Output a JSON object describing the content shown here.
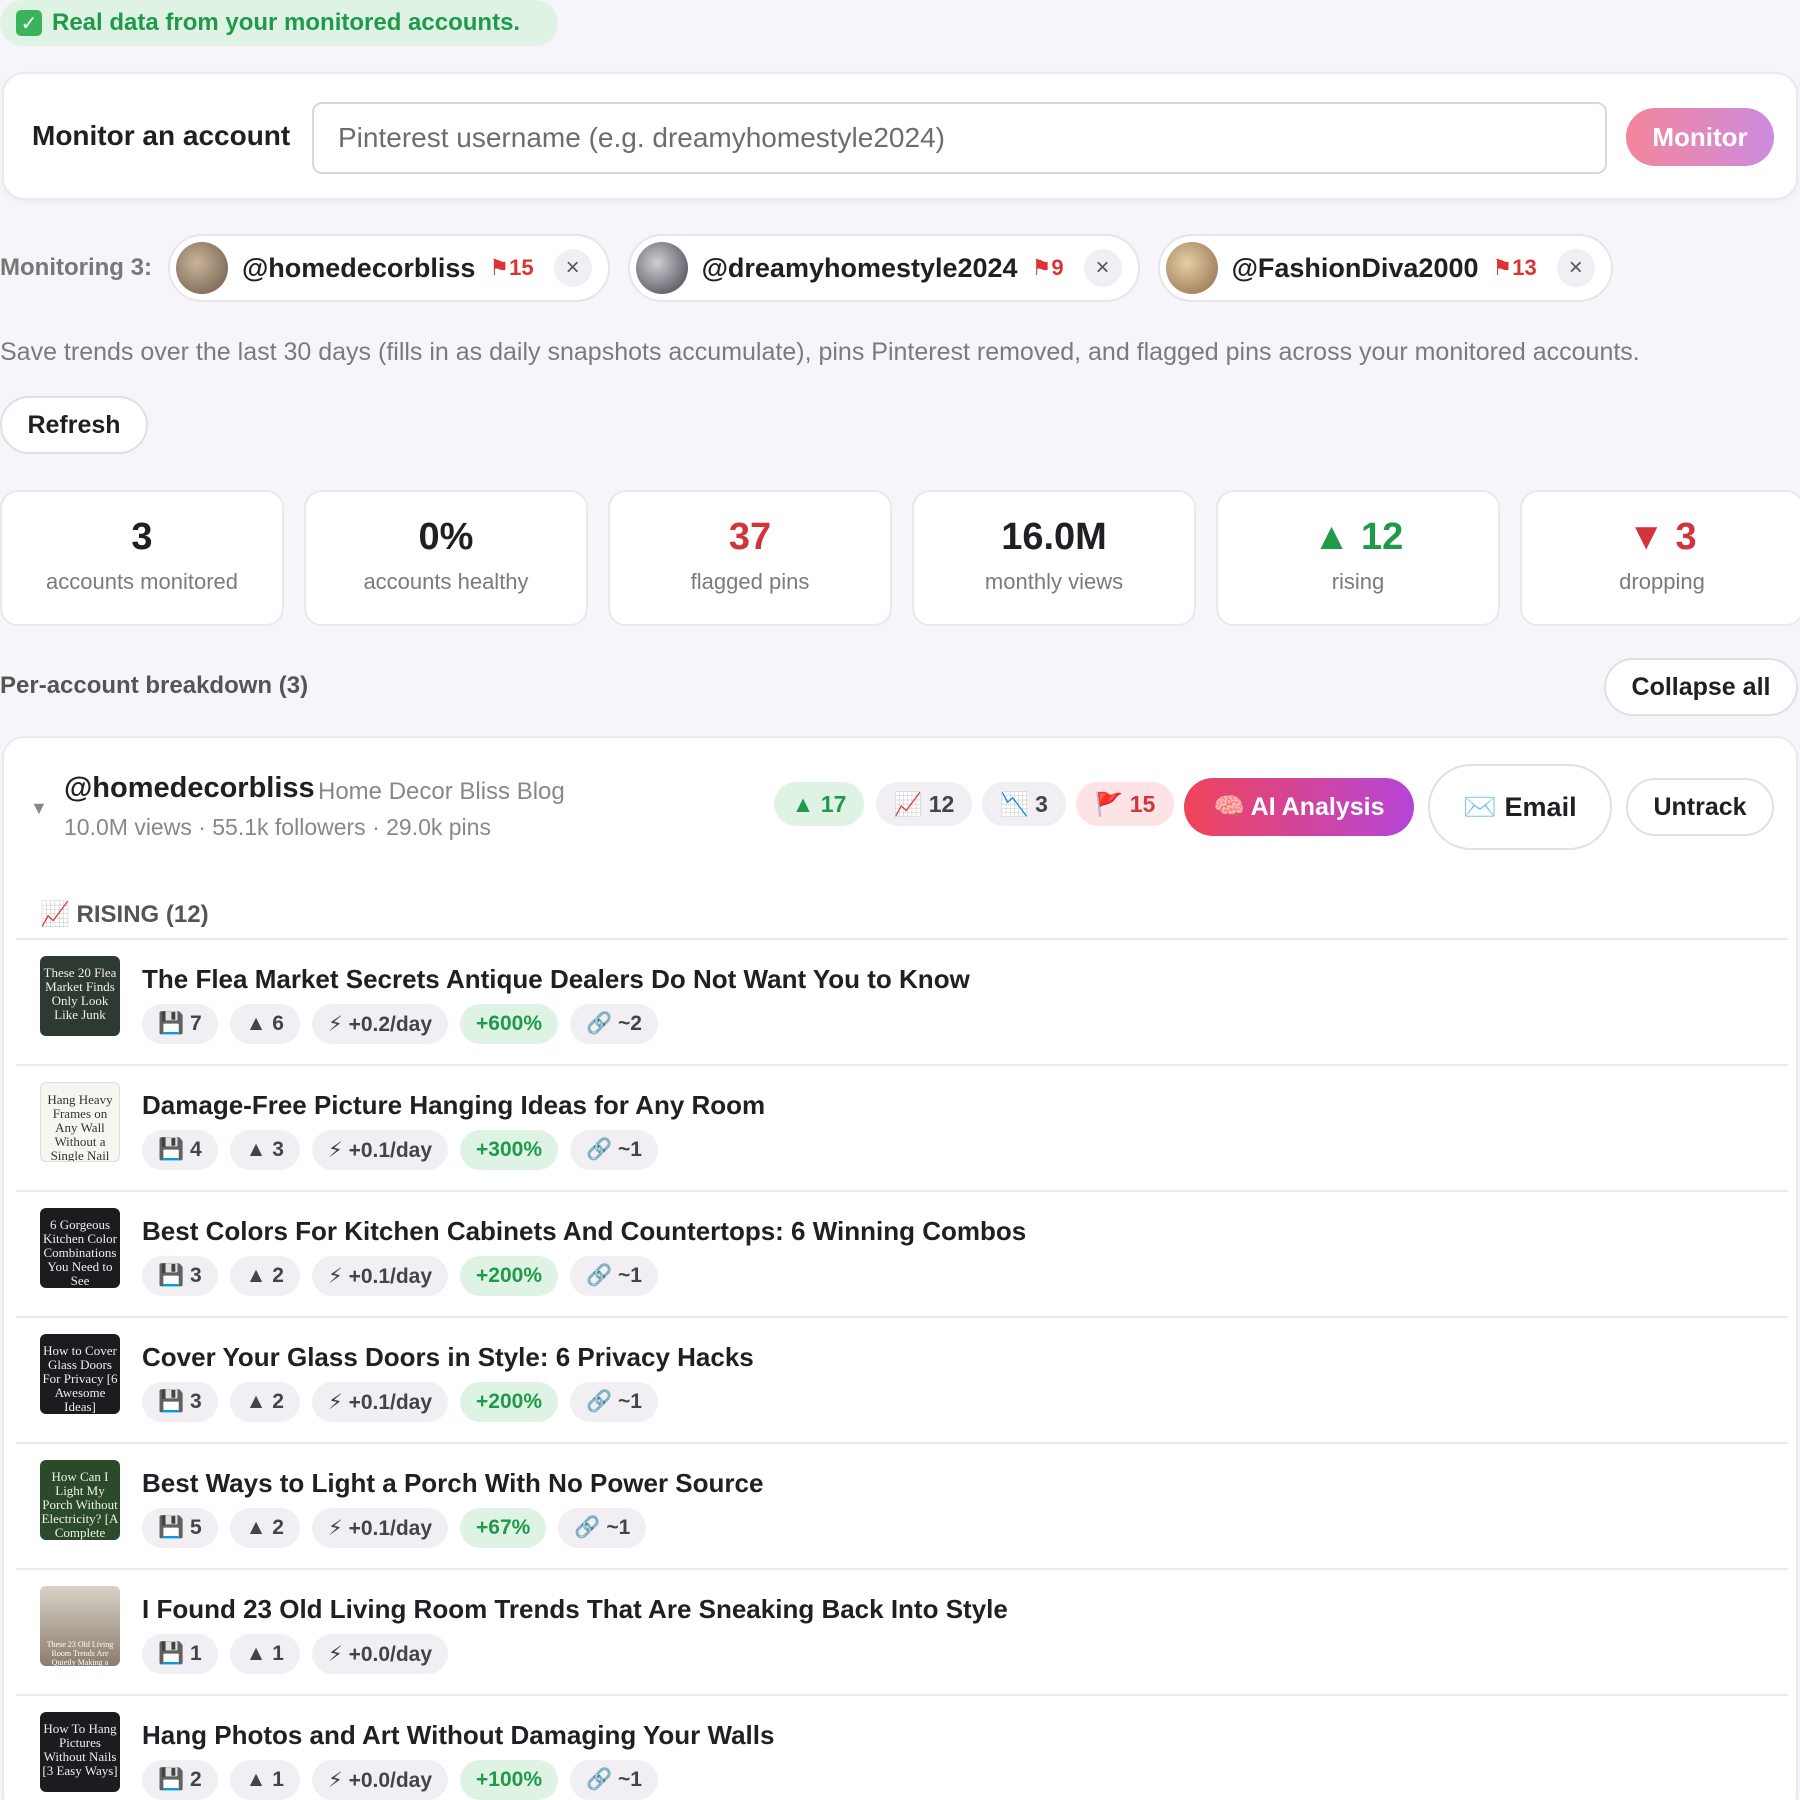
{
  "banner": {
    "text": "Real data from your monitored accounts.",
    "icon": "check-icon"
  },
  "monitor": {
    "label": "Monitor an account",
    "placeholder": "Pinterest username (e.g. dreamyhomestyle2024)",
    "button": "Monitor"
  },
  "monitoring": {
    "label": "Monitoring 3:",
    "accounts": [
      {
        "name": "@homedecorbliss",
        "flags": "15"
      },
      {
        "name": "@dreamyhomestyle2024",
        "flags": "9"
      },
      {
        "name": "@FashionDiva2000",
        "flags": "13"
      }
    ]
  },
  "description": "Save trends over the last 30 days (fills in as daily snapshots accumulate), pins Pinterest removed, and flagged pins across your monitored accounts.",
  "refresh_label": "Refresh",
  "stats": [
    {
      "value": "3",
      "label": "accounts monitored"
    },
    {
      "value": "0%",
      "label": "accounts healthy"
    },
    {
      "value": "37",
      "label": "flagged pins"
    },
    {
      "value": "16.0M",
      "label": "monthly views"
    },
    {
      "value": "▲ 12",
      "label": "rising"
    },
    {
      "value": "▼ 3",
      "label": "dropping"
    }
  ],
  "breakdown": {
    "title": "Per-account breakdown (3)",
    "collapse": "Collapse all"
  },
  "account": {
    "name": "@homedecorbliss",
    "subtitle": "Home Decor Bliss Blog",
    "meta": "10.0M views · 55.1k followers · 29.0k pins",
    "pills": {
      "up": "▲ 17",
      "rising": "📈 12",
      "dropping": "📉 3",
      "flags": "🚩 15"
    },
    "ai_label": "🧠 AI Analysis",
    "email_label": "✉️ Email",
    "untrack_label": "Untrack",
    "rising_header": "📈 RISING (12)"
  },
  "pins": [
    {
      "title": "The Flea Market Secrets Antique Dealers Do Not Want You to Know",
      "thumb": "These 20 Flea Market Finds Only Look Like Junk",
      "saves": "💾 7",
      "up": "▲ 6",
      "rate": "⚡ +0.2/day",
      "pct": "+600%",
      "links": "🔗 ~2"
    },
    {
      "title": "Damage-Free Picture Hanging Ideas for Any Room",
      "thumb": "Hang Heavy Frames on Any Wall Without a Single Nail",
      "saves": "💾 4",
      "up": "▲ 3",
      "rate": "⚡ +0.1/day",
      "pct": "+300%",
      "links": "🔗 ~1"
    },
    {
      "title": "Best Colors For Kitchen Cabinets And Countertops: 6 Winning Combos",
      "thumb": "6 Gorgeous Kitchen Color Combinations You Need to See",
      "saves": "💾 3",
      "up": "▲ 2",
      "rate": "⚡ +0.1/day",
      "pct": "+200%",
      "links": "🔗 ~1"
    },
    {
      "title": "Cover Your Glass Doors in Style: 6 Privacy Hacks",
      "thumb": "How to Cover Glass Doors For Privacy [6 Awesome Ideas]",
      "saves": "💾 3",
      "up": "▲ 2",
      "rate": "⚡ +0.1/day",
      "pct": "+200%",
      "links": "🔗 ~1"
    },
    {
      "title": "Best Ways to Light a Porch With No Power Source",
      "thumb": "How Can I Light My Porch Without Electricity? [A Complete Guide]",
      "saves": "💾 5",
      "up": "▲ 2",
      "rate": "⚡ +0.1/day",
      "pct": "+67%",
      "links": "🔗 ~1"
    },
    {
      "title": "I Found 23 Old Living Room Trends That Are Sneaking Back Into Style",
      "thumb": "These 23 Old Living Room Trends Are Quietly Making a",
      "saves": "💾 1",
      "up": "▲ 1",
      "rate": "⚡ +0.0/day",
      "pct": "",
      "links": ""
    },
    {
      "title": "Hang Photos and Art Without Damaging Your Walls",
      "thumb": "How To Hang Pictures Without Nails [3 Easy Ways]",
      "saves": "💾 2",
      "up": "▲ 1",
      "rate": "⚡ +0.0/day",
      "pct": "+100%",
      "links": "🔗 ~1"
    }
  ]
}
